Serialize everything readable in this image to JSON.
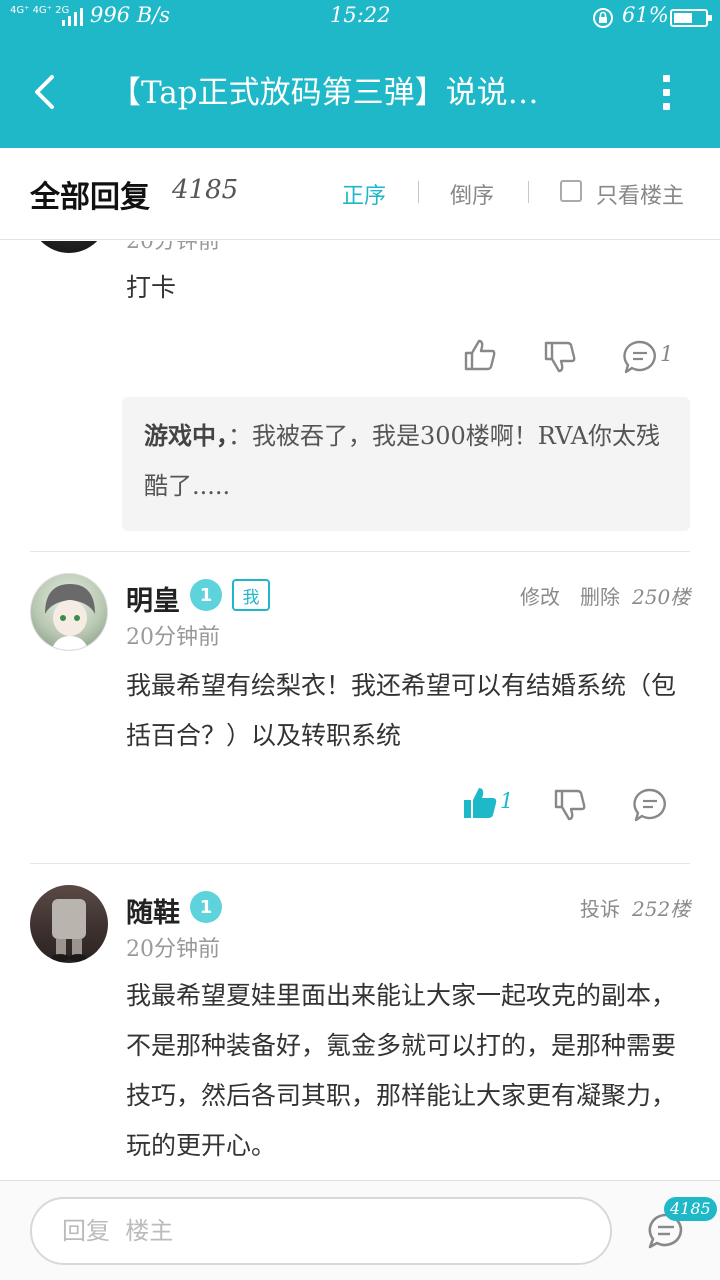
{
  "colors": {
    "accent": "#1fb8c8",
    "level_badge": "#5fd3dc"
  },
  "status_bar": {
    "network": "4G⁺ 4G⁺ 2G",
    "speed": "996 B/s",
    "time": "15:22",
    "battery": "61%",
    "battery_level": 0.61
  },
  "nav": {
    "title": "【Tap正式放码第三弹】说说…",
    "back_icon": "chevron-left-icon",
    "more_icon": "more-vertical-icon"
  },
  "reply_header": {
    "title": "全部回复",
    "count": "4185",
    "sort_asc": "正序",
    "sort_desc": "倒序",
    "op_only": "只看楼主"
  },
  "comments": [
    {
      "time": "20分钟前",
      "body": "打卡",
      "like_count": "",
      "reply_count": "1",
      "quote": {
        "author": "游戏中，",
        "text": "：我被吞了，我是300楼啊！RVA你太残酷了....."
      }
    },
    {
      "user": "明皇",
      "level": "1",
      "me_tag": "我",
      "time": "20分钟前",
      "edit": "修改",
      "delete": "删除",
      "floor": "250楼",
      "body": "我最希望有绘梨衣！我还希望可以有结婚系统（包括百合？）以及转职系统",
      "like_count": "1"
    },
    {
      "user": "随鞋",
      "level": "1",
      "time": "20分钟前",
      "report": "投诉",
      "floor": "252楼",
      "body": "我最希望夏娃里面出来能让大家一起攻克的副本，不是那种装备好，氪金多就可以打的，是那种需要技巧，然后各司其职，那样能让大家更有凝聚力，玩的更开心。"
    }
  ],
  "bottom_bar": {
    "placeholder": "回复  楼主",
    "badge": "4185"
  }
}
